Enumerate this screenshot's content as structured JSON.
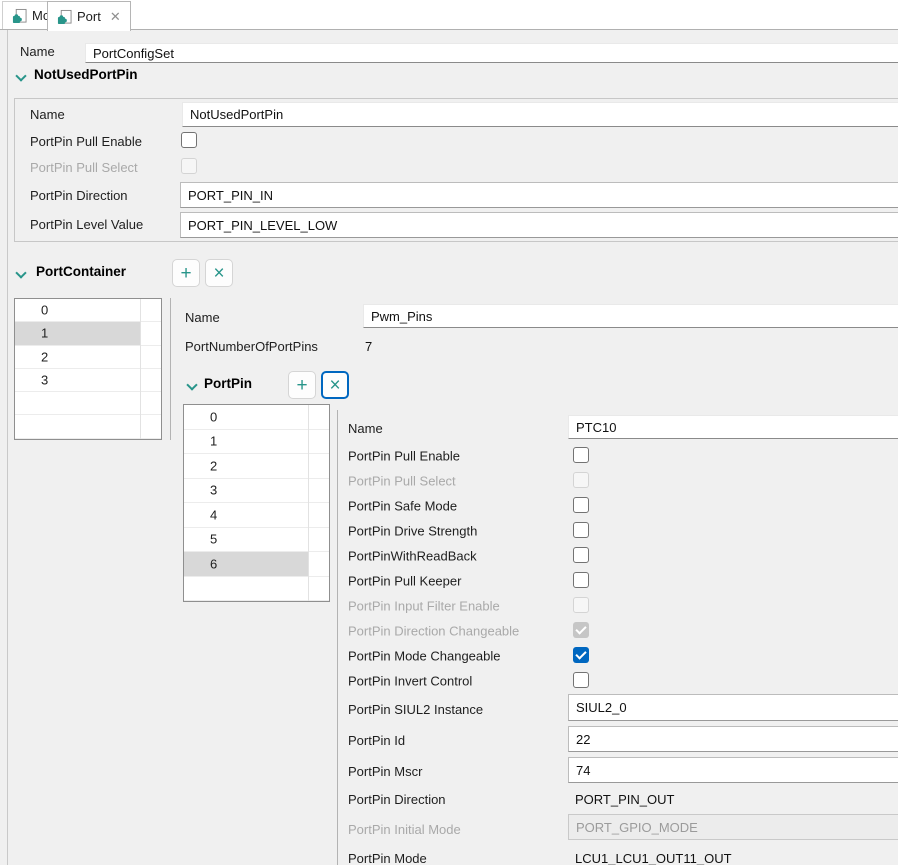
{
  "colors": {
    "teal": "#28958a",
    "blue": "#0067c0",
    "selection": "#d8d8d8"
  },
  "tabs": {
    "mcl": {
      "label": "Mcl"
    },
    "port": {
      "label": "Port",
      "close": "✕"
    }
  },
  "header_field": {
    "label": "Name",
    "value": "PortConfigSet"
  },
  "not_used": {
    "title": "NotUsedPortPin",
    "name": {
      "label": "Name",
      "value": "NotUsedPortPin"
    },
    "pull_enable": {
      "label": "PortPin Pull Enable",
      "state": "unchecked"
    },
    "pull_select": {
      "label": "PortPin Pull Select",
      "state": "disabled"
    },
    "direction": {
      "label": "PortPin Direction",
      "value": "PORT_PIN_IN"
    },
    "level_value": {
      "label": "PortPin Level Value",
      "value": "PORT_PIN_LEVEL_LOW"
    }
  },
  "port_container": {
    "title": "PortContainer",
    "add_label": "+",
    "remove_label": "×",
    "list": {
      "rows": [
        "0",
        "1",
        "2",
        "3"
      ],
      "selected_index": 1,
      "trailing_empty": 2
    },
    "name": {
      "label": "Name",
      "value": "Pwm_Pins"
    },
    "num_pins": {
      "label": "PortNumberOfPortPins",
      "value": "7"
    }
  },
  "port_pin": {
    "title": "PortPin",
    "add_label": "+",
    "remove_label": "×",
    "list": {
      "rows": [
        "0",
        "1",
        "2",
        "3",
        "4",
        "5",
        "6"
      ],
      "selected_index": 6,
      "trailing_empty": 1
    },
    "name": {
      "label": "Name",
      "value": "PTC10"
    },
    "checkboxes": [
      {
        "label": "PortPin Pull Enable",
        "state": "unchecked"
      },
      {
        "label": "PortPin Pull Select",
        "state": "disabled"
      },
      {
        "label": "PortPin Safe Mode",
        "state": "unchecked"
      },
      {
        "label": "PortPin Drive Strength",
        "state": "unchecked"
      },
      {
        "label": "PortPinWithReadBack",
        "state": "unchecked"
      },
      {
        "label": "PortPin Pull Keeper",
        "state": "unchecked"
      },
      {
        "label": "PortPin Input Filter Enable",
        "state": "disabled"
      },
      {
        "label": "PortPin Direction Changeable",
        "state": "disabled-checked"
      },
      {
        "label": "PortPin Mode Changeable",
        "state": "checked"
      },
      {
        "label": "PortPin Invert Control",
        "state": "unchecked"
      }
    ],
    "siul2": {
      "label": "PortPin SIUL2 Instance",
      "value": "SIUL2_0"
    },
    "pin_id": {
      "label": "PortPin Id",
      "value": "22"
    },
    "mscr": {
      "label": "PortPin Mscr",
      "value": "74"
    },
    "direction": {
      "label": "PortPin Direction",
      "value": "PORT_PIN_OUT"
    },
    "initial_mode": {
      "label": "PortPin Initial Mode",
      "value": "PORT_GPIO_MODE"
    },
    "mode": {
      "label": "PortPin Mode",
      "value": "LCU1_LCU1_OUT11_OUT"
    }
  }
}
